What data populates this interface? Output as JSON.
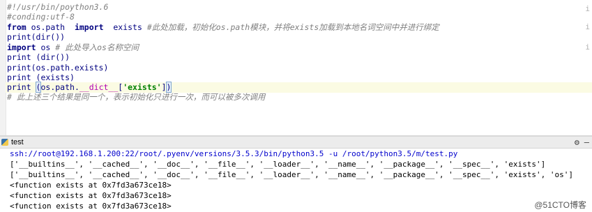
{
  "editor": {
    "lines": {
      "l1": "#!/usr/bin/poython3.6",
      "l2": "#conding:utf-8",
      "l3a": "from",
      "l3b": " os.path  ",
      "l3c": "import",
      "l3d": "  exists ",
      "l3e": "#此处加载，初始化os.path模块，并将exists加载到本地名词空间中并进行绑定",
      "l4": "print(dir())",
      "l5a": "import",
      "l5b": " os ",
      "l5c": "# 此处导入os名称空间",
      "l6": "print (dir())",
      "l7": "print(os.path.exists)",
      "l8": "print (exists)",
      "l9a": "print ",
      "l9b": "(",
      "l9c": "os.path.",
      "l9d": "__dict__",
      "l9e": "[",
      "l9f": "'exists'",
      "l9g": "]",
      "l9h": ")",
      "l10": "# 此上述三个结果是同一个，表示初始化只进行一次，而可以被多次调用"
    },
    "right_marks": [
      "i",
      "i",
      "i"
    ]
  },
  "run_panel": {
    "tab_label": "test",
    "gear": "⚙",
    "minimize": "–"
  },
  "console": {
    "lines": [
      "ssh://root@192.168.1.200:22/root/.pyenv/versions/3.5.3/bin/python3.5 -u /root/python3.5/m/test.py",
      "['__builtins__', '__cached__', '__doc__', '__file__', '__loader__', '__name__', '__package__', '__spec__', 'exists']",
      "['__builtins__', '__cached__', '__doc__', '__file__', '__loader__', '__name__', '__package__', '__spec__', 'exists', 'os']",
      "<function exists at 0x7fd3a673ce18>",
      "<function exists at 0x7fd3a673ce18>",
      "<function exists at 0x7fd3a673ce18>"
    ]
  },
  "watermark": "@51CTO博客"
}
